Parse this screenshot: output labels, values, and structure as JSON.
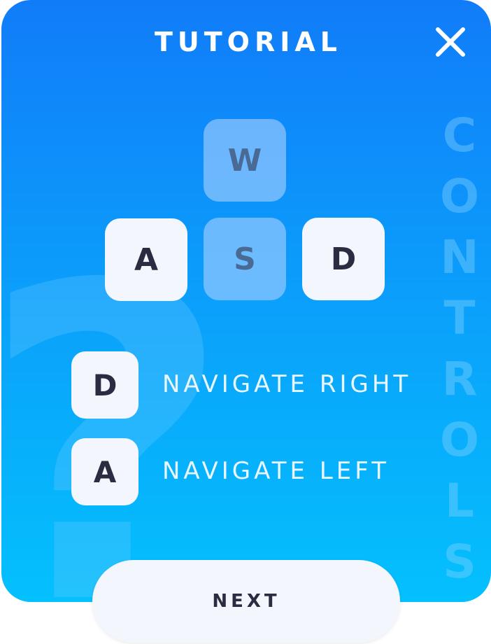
{
  "tutorial": {
    "title": "TUTORIAL",
    "close_icon": "close-icon",
    "side_word_letters": [
      "C",
      "O",
      "N",
      "T",
      "R",
      "O",
      "L",
      "S"
    ],
    "keys": {
      "w": "W",
      "a": "A",
      "s": "S",
      "d": "D"
    },
    "actions": [
      {
        "key": "D",
        "label": "NAVIGATE RIGHT"
      },
      {
        "key": "A",
        "label": "NAVIGATE LEFT"
      }
    ],
    "next_label": "NEXT"
  },
  "colors": {
    "gradient_top": "#117cf9",
    "gradient_bottom": "#04c0fd",
    "key_light": "#f4f6fd",
    "key_text": "#2a2d41",
    "key_dim": "#a0cdff"
  }
}
